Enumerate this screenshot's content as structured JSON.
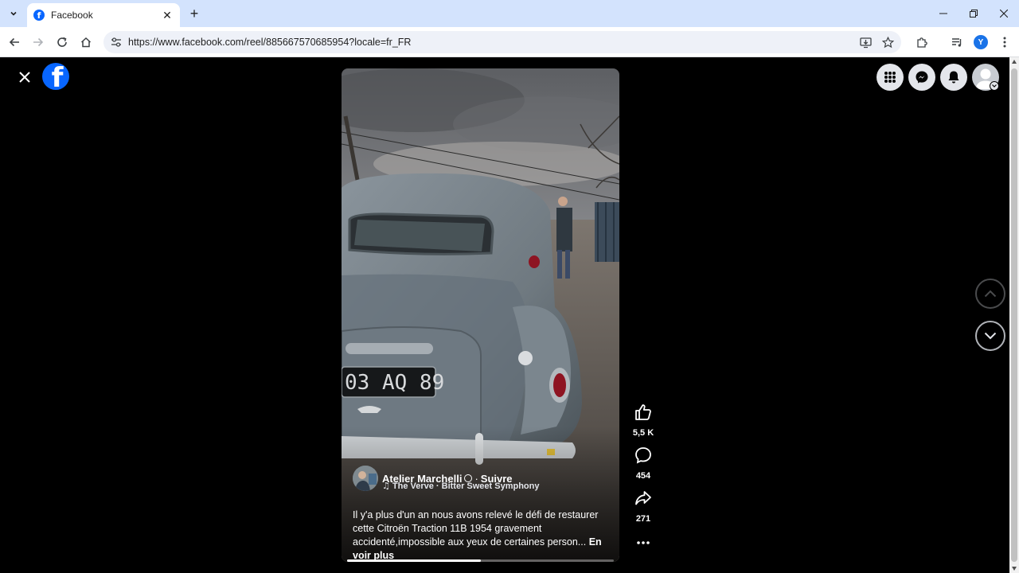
{
  "browser": {
    "tab_title": "Facebook",
    "tab_favicon": "f",
    "url": "https://www.facebook.com/reel/885667570685954?locale=fr_FR",
    "profile_initial": "Y"
  },
  "reel": {
    "author": "Atelier Marchelli",
    "separator": "·",
    "follow_label": "Suivre",
    "music": "The Verve · Bitter Sweet Symphony",
    "caption": "Il y'a plus d'un an nous avons relevé le défi de restaurer cette Citroën Traction 11B 1954 gravement accidenté,impossible aux yeux de certaines person... ",
    "see_more": "En voir plus",
    "plate": "03 AQ 89",
    "progress": 0.5
  },
  "actions": {
    "likes": "5,5 K",
    "comments": "454",
    "shares": "271"
  },
  "colors": {
    "facebook_blue": "#0866ff",
    "tabbar": "#d3e3fd"
  }
}
